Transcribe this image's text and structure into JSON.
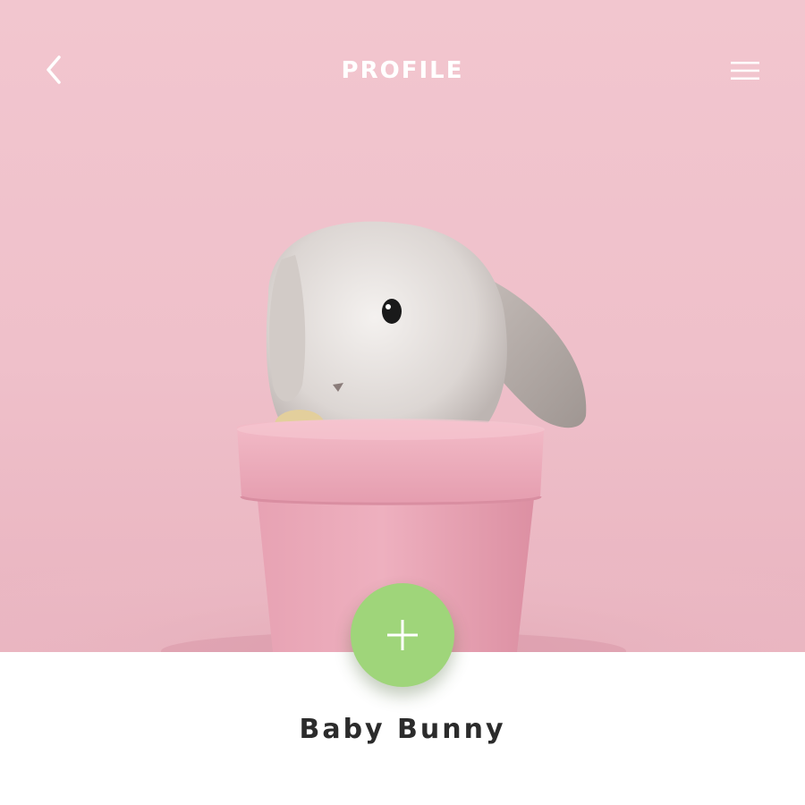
{
  "header": {
    "title": "PROFILE",
    "back_icon": "chevron-left-icon",
    "menu_icon": "hamburger-menu-icon"
  },
  "hero": {
    "image": "baby-bunny-in-pink-flower-pot",
    "background_color": "#f0c3cc"
  },
  "fab": {
    "icon": "plus-icon",
    "color": "#9fd57a"
  },
  "profile": {
    "name": "Baby Bunny"
  }
}
